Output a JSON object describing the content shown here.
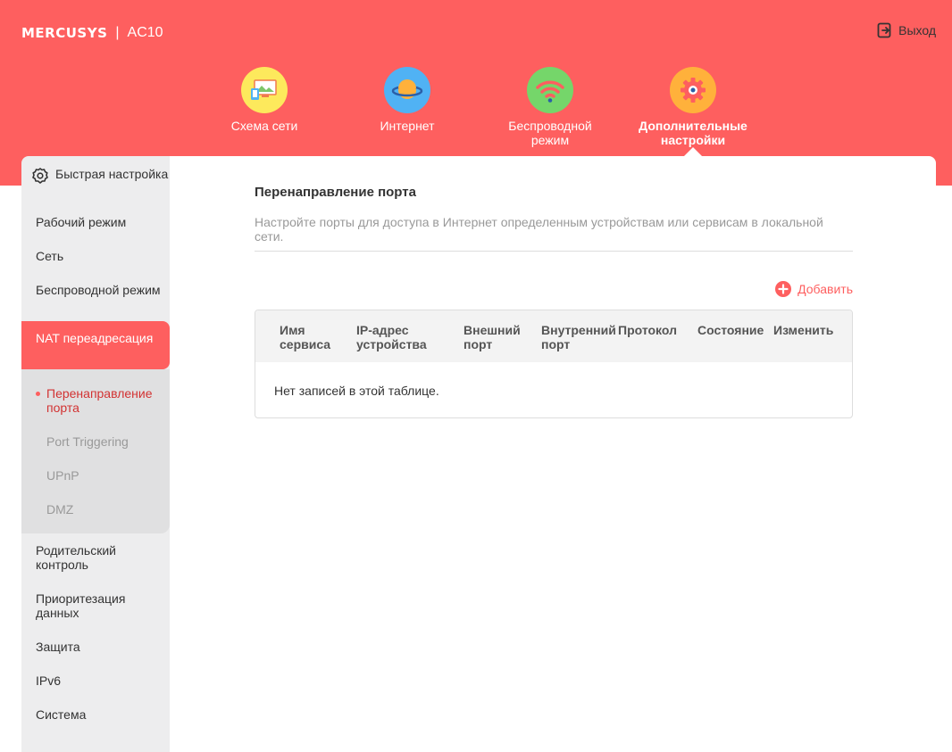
{
  "brand": {
    "logo": "MERCUSYS",
    "separator": "|",
    "model": "AC10"
  },
  "logout": {
    "label": "Выход"
  },
  "topnav": [
    {
      "label": "Схема сети",
      "icon": "network-map-icon",
      "color": "#fde95c"
    },
    {
      "label": "Интернет",
      "icon": "globe-planet-icon",
      "color": "#50b2f4"
    },
    {
      "label": "Беспроводной режим",
      "icon": "wifi-icon",
      "color": "#75d66a"
    },
    {
      "label": "Дополнительные настройки",
      "icon": "gear-icon",
      "color": "#ffb13b",
      "active": true
    }
  ],
  "sidebar": {
    "items": [
      {
        "label": "Быстрая настройка",
        "icon": "settings-gear-icon"
      },
      {
        "label": "Рабочий режим"
      },
      {
        "label": "Сеть"
      },
      {
        "label": "Беспроводной режим"
      },
      {
        "label": "NAT переадресация",
        "active": true
      },
      {
        "label": "Родительский контроль"
      },
      {
        "label": "Приоритезация данных"
      },
      {
        "label": "Защита"
      },
      {
        "label": "IPv6"
      },
      {
        "label": "Система"
      }
    ],
    "subitems": [
      {
        "label": "Перенаправление порта",
        "active": true
      },
      {
        "label": "Port Triggering"
      },
      {
        "label": "UPnP"
      },
      {
        "label": "DMZ"
      }
    ]
  },
  "main": {
    "title": "Перенаправление порта",
    "description": "Настройте порты для доступа в Интернет определенным устройствам или сервисам в локальной сети.",
    "add_label": "Добавить",
    "table": {
      "columns": [
        "Имя сервиса",
        "IP-адрес устройства",
        "Внешний порт",
        "Внутренний порт",
        "Протокол",
        "Состояние",
        "Изменить"
      ],
      "empty": "Нет записей в этой таблице."
    }
  },
  "colors": {
    "accent": "#fe5f5f",
    "sidebar_bg": "#ededee",
    "sub_bg": "#e0e0e1"
  }
}
